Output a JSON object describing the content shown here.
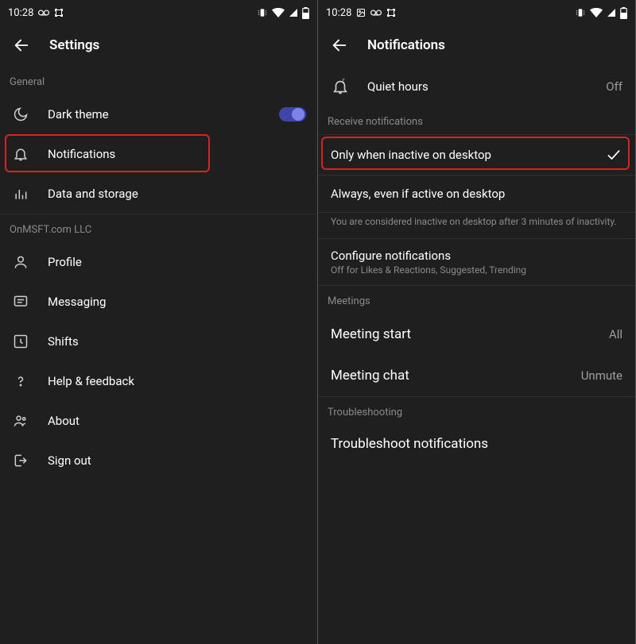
{
  "status": {
    "time": "10:28"
  },
  "left": {
    "title": "Settings",
    "section_general": "General",
    "items": {
      "dark_theme": "Dark theme",
      "notifications": "Notifications",
      "data_storage": "Data and storage"
    },
    "section_org": "OnMSFT.com LLC",
    "org_items": {
      "profile": "Profile",
      "messaging": "Messaging",
      "shifts": "Shifts",
      "help": "Help & feedback",
      "about": "About",
      "signout": "Sign out"
    }
  },
  "right": {
    "title": "Notifications",
    "quiet_hours": {
      "label": "Quiet hours",
      "value": "Off"
    },
    "section_receive": "Receive notifications",
    "receive_options": {
      "inactive": "Only when inactive on desktop",
      "always": "Always, even if active on desktop"
    },
    "inactive_note": "You are considered inactive on desktop after 3 minutes of inactivity.",
    "configure": {
      "label": "Configure notifications",
      "sub": "Off for Likes & Reactions, Suggested, Trending"
    },
    "section_meetings": "Meetings",
    "meetings": {
      "start": {
        "label": "Meeting start",
        "value": "All"
      },
      "chat": {
        "label": "Meeting chat",
        "value": "Unmute"
      }
    },
    "section_troubleshooting": "Troubleshooting",
    "troubleshoot": "Troubleshoot notifications"
  }
}
